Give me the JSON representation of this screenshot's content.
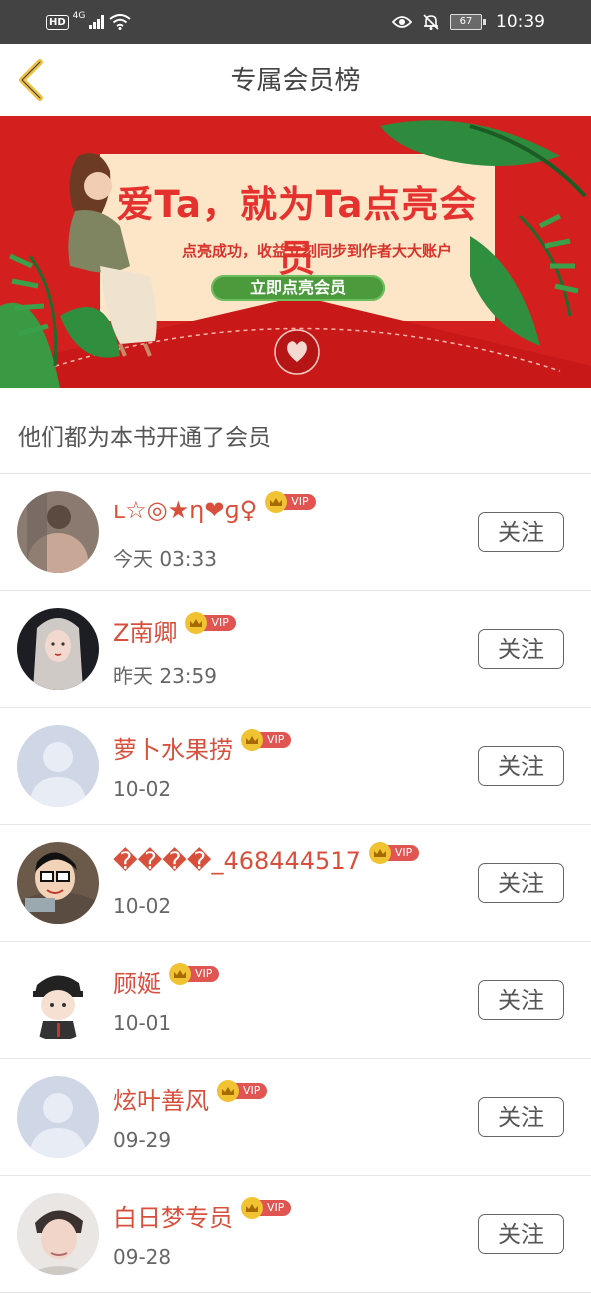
{
  "status_bar": {
    "hd": "HD",
    "network": "4G",
    "battery": "67",
    "time": "10:39"
  },
  "nav": {
    "title": "专属会员榜"
  },
  "banner": {
    "title": "爱Ta，就为Ta点亮会员",
    "subtitle": "点亮成功，收益立刻同步到作者大大账户",
    "cta": "立即点亮会员"
  },
  "section": {
    "header": "他们都为本书开通了会员"
  },
  "vip_label": "VIP",
  "members": [
    {
      "name": "ʟ☆◎★η❤ɡ♀",
      "time": "今天 03:33",
      "follow": "关注"
    },
    {
      "name": "Z南卿",
      "time": "昨天 23:59",
      "follow": "关注"
    },
    {
      "name": "萝卜水果捞",
      "time": "10-02",
      "follow": "关注"
    },
    {
      "name": "����_468444517",
      "time": "10-02",
      "follow": "关注"
    },
    {
      "name": "顾娫",
      "time": "10-01",
      "follow": "关注"
    },
    {
      "name": "炫叶善风",
      "time": "09-29",
      "follow": "关注"
    },
    {
      "name": "白日梦专员",
      "time": "09-28",
      "follow": "关注"
    }
  ],
  "colors": {
    "accent_name": "#d8503c",
    "banner_red": "#d41f1f",
    "vip_red": "#e05451",
    "vip_gold": "#f1c232",
    "back_arrow": "#f0c040"
  }
}
